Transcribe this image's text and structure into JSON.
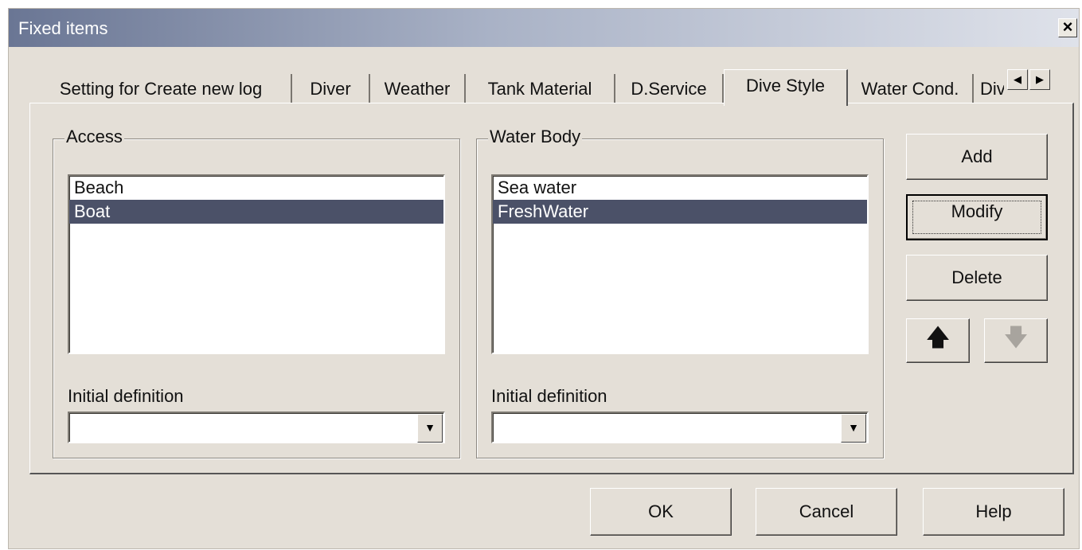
{
  "window": {
    "title": "Fixed items",
    "close_glyph": "×"
  },
  "tabs": [
    {
      "label": "Setting for Create new log"
    },
    {
      "label": "Diver"
    },
    {
      "label": "Weather"
    },
    {
      "label": "Tank Material"
    },
    {
      "label": "D.Service"
    },
    {
      "label": "Dive Style",
      "active": true
    },
    {
      "label": "Water Cond."
    },
    {
      "label": "Div"
    }
  ],
  "tab_scroll": {
    "left": "◀",
    "right": "▶"
  },
  "access": {
    "label": "Access",
    "items": [
      {
        "text": "Beach"
      },
      {
        "text": "Boat",
        "selected": true
      }
    ],
    "initial_label": "Initial definition",
    "initial_value": ""
  },
  "water_body": {
    "label": "Water Body",
    "items": [
      {
        "text": "Sea water"
      },
      {
        "text": "FreshWater",
        "selected": true
      }
    ],
    "initial_label": "Initial definition",
    "initial_value": ""
  },
  "side_buttons": {
    "add": "Add",
    "modify": "Modify",
    "delete": "Delete",
    "up": "🡅",
    "down": "🡇"
  },
  "footer": {
    "ok": "OK",
    "cancel": "Cancel",
    "help": "Help"
  },
  "combo_arrow": "▼"
}
